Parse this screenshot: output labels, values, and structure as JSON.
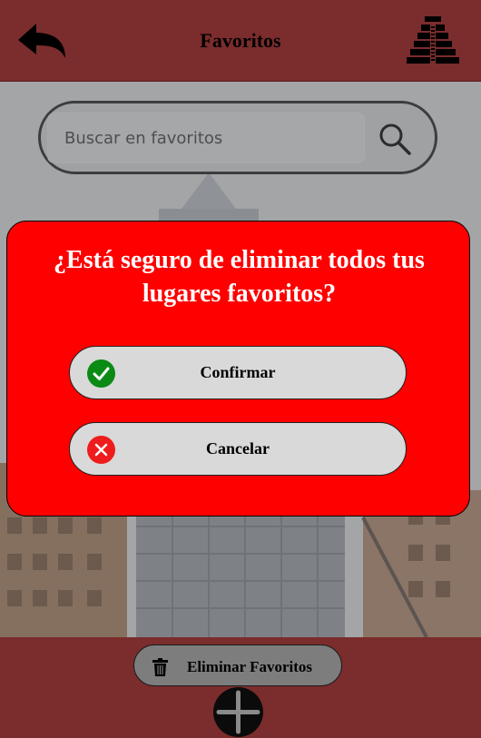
{
  "header": {
    "title": "Favoritos",
    "back_icon": "back-arrow-icon",
    "logo_icon": "pyramid-logo-icon"
  },
  "search": {
    "placeholder": "Buscar en favoritos",
    "value": "",
    "icon": "search-icon"
  },
  "dialog": {
    "message": "¿Está seguro de eliminar todos tus lugares favoritos?",
    "confirm_label": "Confirmar",
    "confirm_icon": "check-icon",
    "cancel_label": "Cancelar",
    "cancel_icon": "close-icon",
    "colors": {
      "background": "#ff0000",
      "confirm": "#0b8a14",
      "cancel": "#ee1c1c"
    }
  },
  "footer": {
    "delete_all_label": "Eliminar Favoritos",
    "delete_icon": "trash-icon",
    "add_icon": "plus-icon"
  },
  "colors": {
    "brand": "#7b2c2c"
  }
}
